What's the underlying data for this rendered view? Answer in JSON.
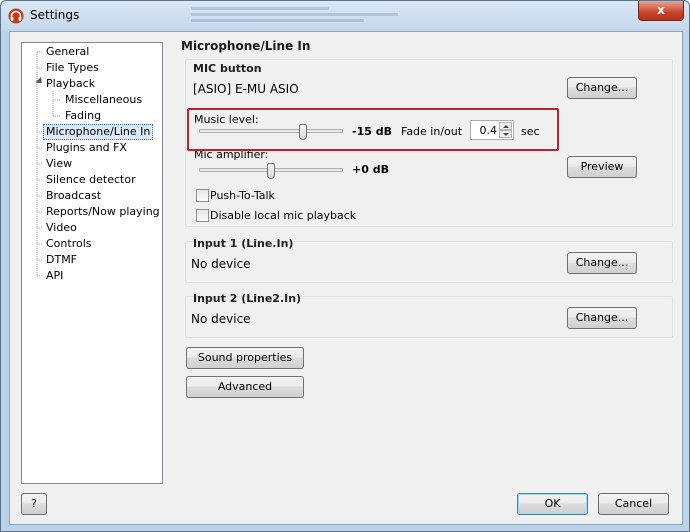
{
  "window": {
    "title": "Settings",
    "close_label": "x"
  },
  "tree": {
    "items": [
      {
        "label": "General"
      },
      {
        "label": "File Types"
      },
      {
        "label": "Playback"
      },
      {
        "label": "Miscellaneous"
      },
      {
        "label": "Fading"
      },
      {
        "label": "Microphone/Line In",
        "selected": true
      },
      {
        "label": "Plugins and FX"
      },
      {
        "label": "View"
      },
      {
        "label": "Silence detector"
      },
      {
        "label": "Broadcast"
      },
      {
        "label": "Reports/Now playing"
      },
      {
        "label": "Video"
      },
      {
        "label": "Controls"
      },
      {
        "label": "DTMF"
      },
      {
        "label": "API"
      }
    ]
  },
  "panel": {
    "title": "Microphone/Line In",
    "mic_group": {
      "title": "MIC button",
      "device": "[ASIO] E-MU ASIO",
      "change_label": "Change...",
      "music_level_label": "Music level:",
      "music_level_value": "-15 dB",
      "music_level_fraction": 0.72,
      "fade_label": "Fade in/out",
      "fade_value": "0.4",
      "fade_unit": "sec",
      "mic_amp_label": "Mic amplifier:",
      "mic_amp_value": "+0 dB",
      "mic_amp_fraction": 0.5,
      "preview_label": "Preview",
      "push_to_talk_label": "Push-To-Talk",
      "disable_local_label": "Disable local mic playback"
    },
    "input1": {
      "title": "Input 1 (Line.In)",
      "device": "No device",
      "change_label": "Change..."
    },
    "input2": {
      "title": "Input 2 (Line2.In)",
      "device": "No device",
      "change_label": "Change..."
    },
    "sound_properties_label": "Sound properties",
    "advanced_label": "Advanced"
  },
  "footer": {
    "help_label": "?",
    "ok_label": "OK",
    "cancel_label": "Cancel"
  },
  "colors": {
    "highlight": "#b3262d",
    "selection": "#dce9f8"
  }
}
